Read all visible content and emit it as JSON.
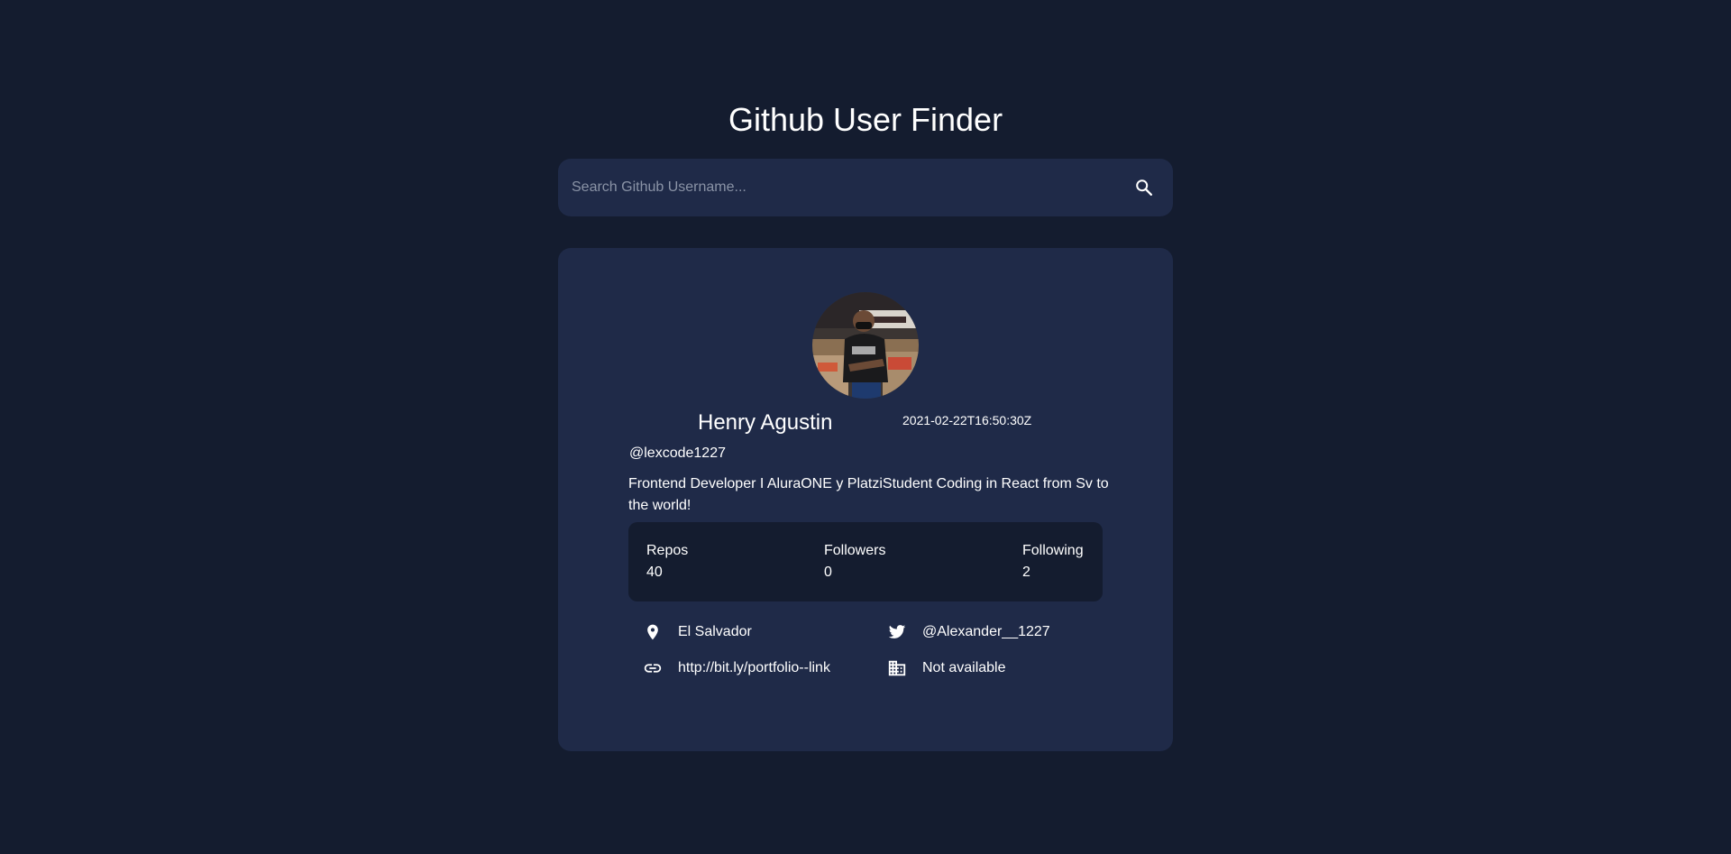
{
  "app": {
    "title": "Github User Finder"
  },
  "search": {
    "placeholder": "Search Github Username...",
    "value": "",
    "button_icon": "search-icon"
  },
  "profile": {
    "avatar_icon": "avatar-photo",
    "name": "Henry Agustin",
    "joined": "2021-02-22T16:50:30Z",
    "login": "@lexcode1227",
    "bio": "Frontend Developer I AluraONE y PlatziStudent Coding in React from Sv to the world!"
  },
  "stats": {
    "repos_label": "Repos",
    "repos_value": "40",
    "followers_label": "Followers",
    "followers_value": "0",
    "following_label": "Following",
    "following_value": "2"
  },
  "links": {
    "location": "El Salvador",
    "twitter": "@Alexander__1227",
    "blog": "http://bit.ly/portfolio--link",
    "company": "Not available"
  },
  "colors": {
    "background": "#141c2f",
    "card": "#1f2a48",
    "text": "#ffffff",
    "placeholder": "#8a93a6"
  }
}
